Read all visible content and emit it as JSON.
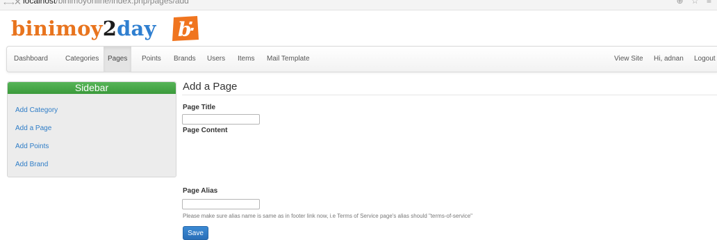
{
  "browser": {
    "back_icon": "←",
    "forward_icon": "→",
    "reload_icon": "✕",
    "url_host": "localhost",
    "url_path": "/binimoyonline/index.php/pages/add",
    "right_icons": "⊕ ☆ ≡"
  },
  "logo": {
    "part1": "binimoy",
    "part2": "2",
    "part3": "day",
    "badge_color": "#f0751f",
    "badge_letter": "b"
  },
  "nav": {
    "dashboard": "Dashboard",
    "categories": "Categories",
    "pages": "Pages",
    "points": "Points",
    "brands": "Brands",
    "users": "Users",
    "items": "Items",
    "mail_template": "Mail Template",
    "view_site": "View Site",
    "greeting": "Hi, adnan",
    "logout": "Logout"
  },
  "sidebar": {
    "title": "Sidebar",
    "links": [
      "Add Category",
      "Add a Page",
      "Add Points",
      "Add Brand"
    ]
  },
  "form": {
    "heading": "Add a Page",
    "page_title_label": "Page Title",
    "page_title_value": "",
    "page_content_label": "Page Content",
    "page_alias_label": "Page Alias",
    "page_alias_value": "",
    "help_text": "Please make sure alias name is same as in footer link now, i.e Terms of Service page's alias should \"terms-of-service\"",
    "save_label": "Save"
  },
  "colors": {
    "sidebar_header": "#4caf50",
    "link": "#2f7dc7",
    "save_button": "#2f7dc7",
    "logo_orange": "#e8741e",
    "logo_blue": "#2f7fd0"
  }
}
